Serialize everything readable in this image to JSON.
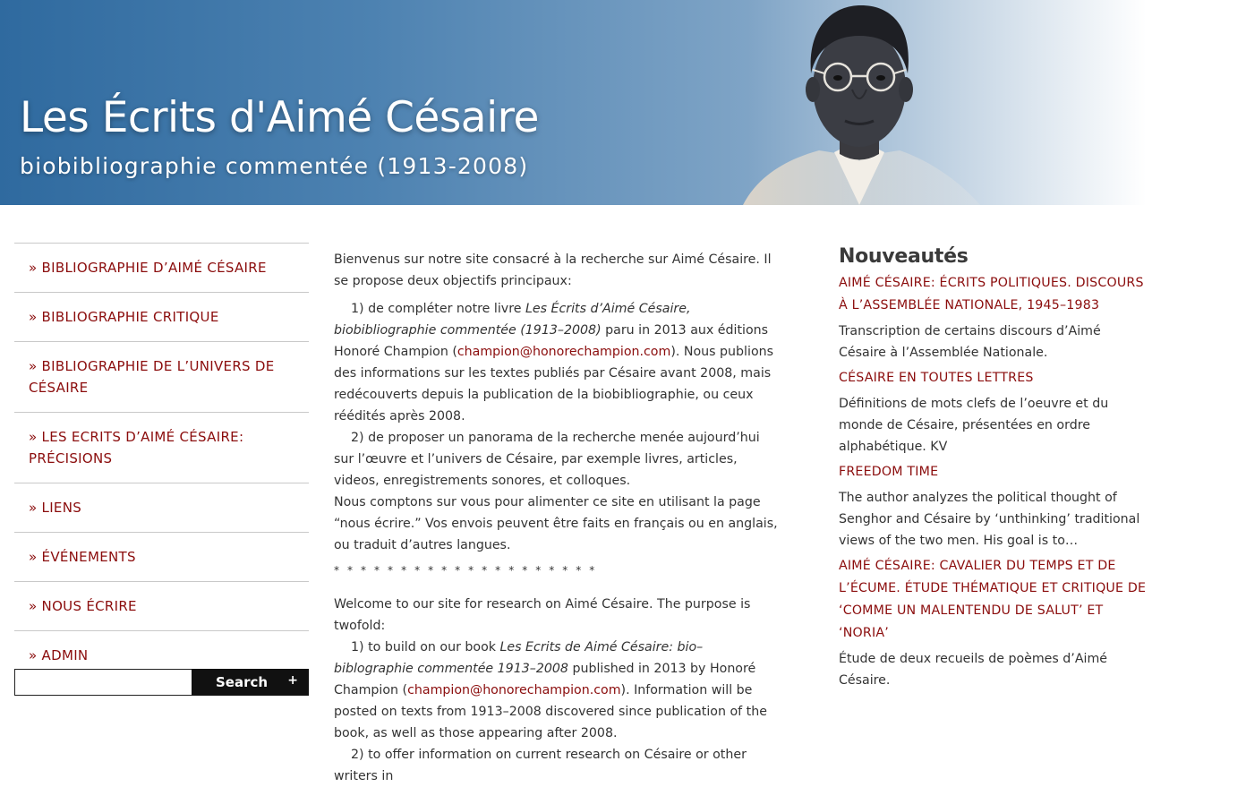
{
  "header": {
    "title": "Les Écrits d'Aimé Césaire",
    "subtitle": "biobibliographie commentée (1913-2008)"
  },
  "colors": {
    "accent_link": "#8b0d0d",
    "banner_blue": "#2f6a9f",
    "text": "#333333"
  },
  "sidebar": {
    "items": [
      {
        "label": "» BIBLIOGRAPHIE D’AIMÉ CÉSAIRE"
      },
      {
        "label": "» BIBLIOGRAPHIE CRITIQUE"
      },
      {
        "label": "» BIBLIOGRAPHIE DE L’UNIVERS DE CÉSAIRE"
      },
      {
        "label": "» LES ECRITS D’AIMÉ CÉSAIRE: PRÉCISIONS"
      },
      {
        "label": "» LIENS"
      },
      {
        "label": "» ÉVÉNEMENTS"
      },
      {
        "label": "» NOUS ÉCRIRE"
      },
      {
        "label": "» ADMIN"
      }
    ],
    "search": {
      "value": "",
      "button_label": "Search",
      "expand_glyph": "+"
    }
  },
  "main": {
    "p1": "Bienvenus sur notre site consacré à la recherche sur Aimé Césaire. Il se propose deux objectifs principaux:",
    "p2_a": "1) de compléter notre livre ",
    "p2_em": "Les Écrits d’Aimé Césaire, biobibliographie commentée (1913–2008)",
    "p2_b": " paru in 2013 aux éditions Honoré Champion (",
    "p2_link": "champion@honorechampion.com",
    "p2_c": "). Nous publions des informations sur les textes publiés par Césaire avant 2008, mais redécouverts depuis la publication de la biobibliographie, ou ceux réédités après 2008.",
    "p3": "2) de proposer un panorama de la recherche menée aujourd’hui sur l’œuvre et l’univers de Césaire, par exemple livres, articles, videos, enregistrements sonores, et colloques.",
    "p4": "Nous comptons sur vous pour alimenter ce site en utilisant la page “nous écrire.” Vos envois peuvent être faits en français ou en anglais, ou traduit d’autres langues.",
    "stars": "* * * * * * * * * * * * * * * * * * * *",
    "en1": "Welcome to our site for research on Aimé Césaire. The purpose is twofold:",
    "en2_a": "1) to build on our book ",
    "en2_em": "Les Ecrits de Aimé Césaire: bio–biblographie commentée 1913–2008",
    "en2_b": " published in 2013 by Honoré Champion (",
    "en2_link": "champion@honorechampion.com",
    "en2_c": "). Information will be posted on texts from 1913–2008 discovered since publication of the book, as well as those appearing after 2008.",
    "en3": "2) to offer information on current research on Césaire or other writers in"
  },
  "news": {
    "heading": "Nouveautés",
    "items": [
      {
        "title": "AIMÉ CÉSAIRE: ÉCRITS POLITIQUES. DISCOURS À L’ASSEMBLÉE NATIONALE, 1945–1983",
        "excerpt": "Transcription de certains discours d’Aimé Césaire à l’Assemblée Nationale."
      },
      {
        "title": "CÉSAIRE EN TOUTES LETTRES",
        "excerpt": "Définitions de mots clefs de l’oeuvre et du monde de Césaire, présentées en ordre alphabétique. KV"
      },
      {
        "title": "FREEDOM TIME",
        "excerpt": "The author analyzes the political thought of Senghor and Césaire by ‘unthinking’ traditional views of the two men. His goal is to…"
      },
      {
        "title": "AIMÉ CÉSAIRE: CAVALIER DU TEMPS ET DE L’ÉCUME. ÉTUDE THÉMATIQUE ET CRITIQUE DE ‘COMME UN MALENTENDU DE SALUT’ ET ‘NORIA’",
        "excerpt": "Étude de deux recueils de poèmes d’Aimé Césaire."
      }
    ]
  }
}
